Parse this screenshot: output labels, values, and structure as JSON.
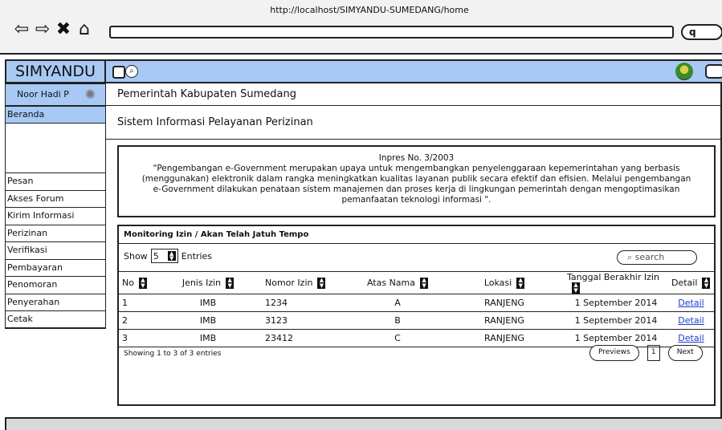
{
  "browser": {
    "url": "http://localhost/SIMYANDU-SUMEDANG/home",
    "icons": [
      "back-arrow-icon",
      "forward-arrow-icon",
      "close-icon",
      "home-icon"
    ],
    "go_label": "q"
  },
  "sidebar": {
    "brand": "SIMYANDU",
    "user": "Noor Hadi P",
    "active_item": "Beranda",
    "items": [
      "Pesan",
      "Akses Forum",
      "Kirim Informasi",
      "Perizinan",
      "Verifikasi",
      "Pembayaran",
      "Penomoran",
      "Penyerahan",
      "Cetak"
    ]
  },
  "header": {
    "line1": "Pemerintah Kabupaten Sumedang",
    "line2": "Sistem Informasi Pelayanan Perizinan"
  },
  "quote": {
    "title": "Inpres No. 3/2003",
    "text": "\"Pengembangan e-Government merupakan upaya untuk mengembangkan penyelenggaraan kepemerintahan yang berbasis (menggunakan) elektronik dalam rangka meningkatkan kualitas layanan publik secara efektif dan efisien. Melalui pengembangan e-Government dilakukan penataan sistem manajemen dan proses kerja di lingkungan pemerintah dengan mengoptimasikan pemanfaatan teknologi informasi \"."
  },
  "monitor": {
    "title": "Monitoring Izin / Akan Telah Jatuh Tempo",
    "show_label": "Show",
    "show_value": "5",
    "entries_label": "Entries",
    "search_placeholder": "search",
    "columns": [
      "No",
      "Jenis Izin",
      "Nomor Izin",
      "Atas Nama",
      "Lokasi",
      "Tanggal Berakhir Izin",
      "Detail"
    ],
    "rows": [
      {
        "no": "1",
        "jenis": "IMB",
        "nomor": "1234",
        "nama": "A",
        "lokasi": "RANJENG",
        "tanggal": "1 September 2014",
        "detail": "Detail"
      },
      {
        "no": "2",
        "jenis": "IMB",
        "nomor": "3123",
        "nama": "B",
        "lokasi": "RANJENG",
        "tanggal": "1 September 2014",
        "detail": "Detail"
      },
      {
        "no": "3",
        "jenis": "IMB",
        "nomor": "23412",
        "nama": "C",
        "lokasi": "RANJENG",
        "tanggal": "1 September 2014",
        "detail": "Detail"
      }
    ],
    "footer": "Showing 1 to 3 of 3 entries",
    "prev_label": "Previews",
    "page": "1",
    "next_label": "Next"
  }
}
